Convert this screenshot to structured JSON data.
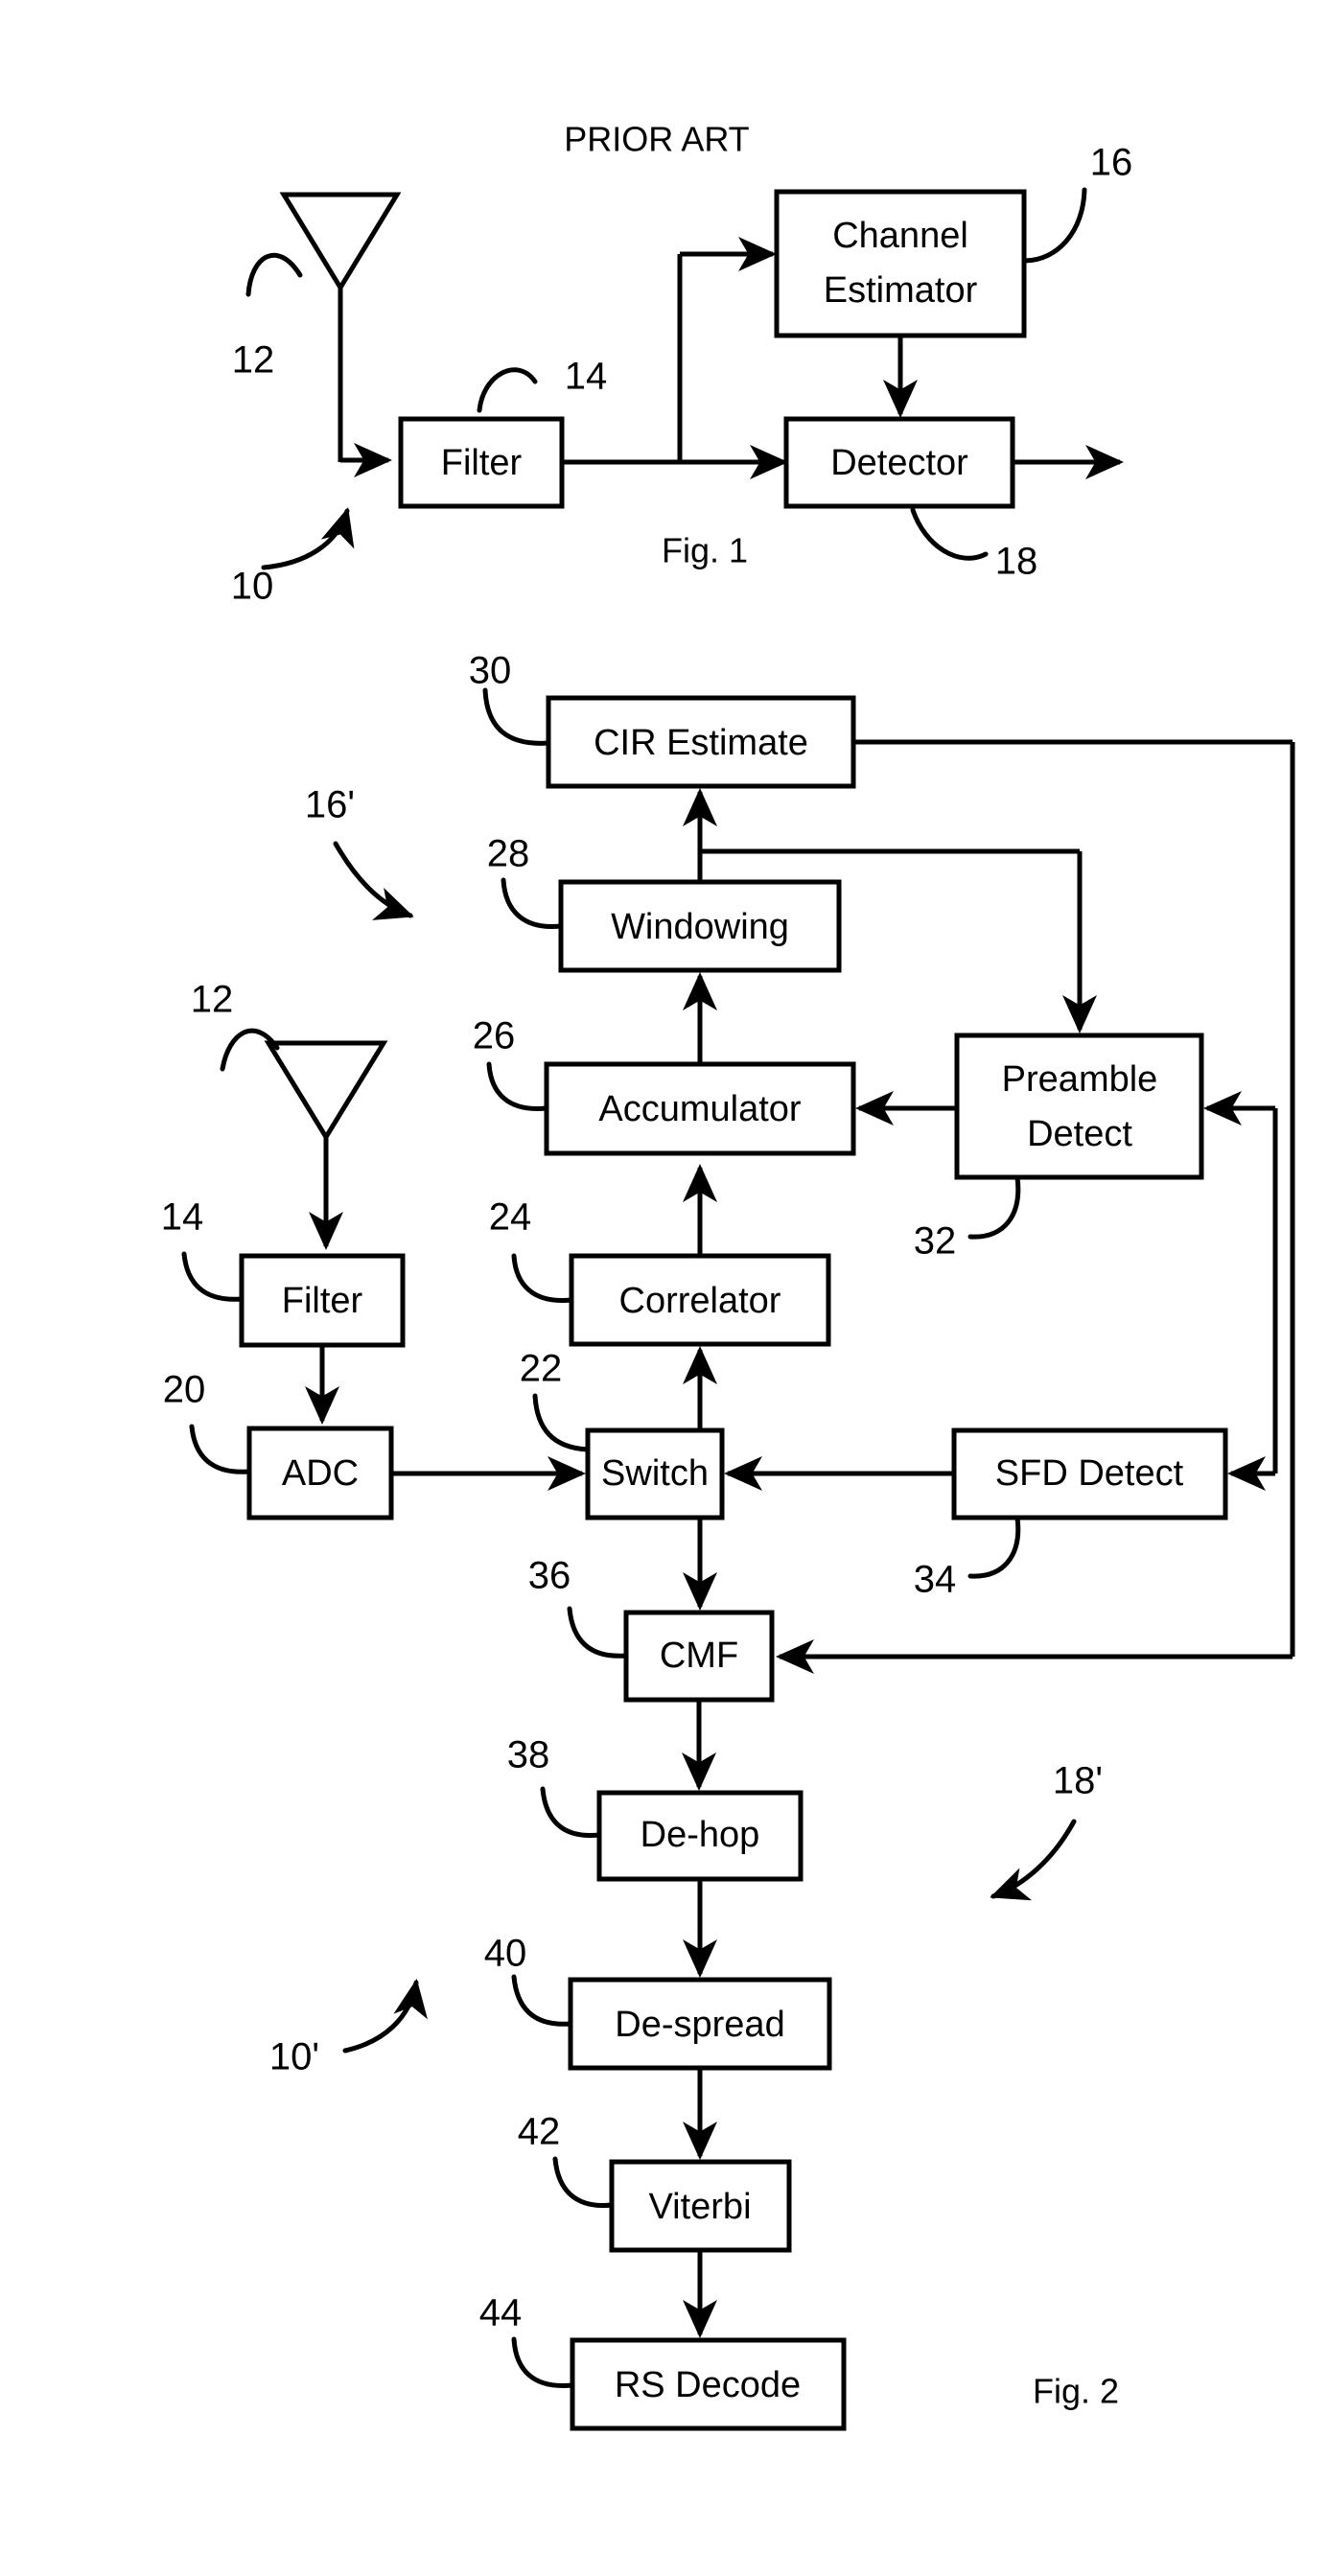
{
  "document": {
    "type": "patent-figure-sheet",
    "figures": [
      {
        "id": "fig1",
        "caption": "Fig. 1",
        "note": "PRIOR ART",
        "system_ref": "10",
        "subsystem_refs": [
          "16'",
          "18'"
        ],
        "blocks": [
          {
            "ref": "12",
            "label": "",
            "kind": "antenna"
          },
          {
            "ref": "14",
            "label": "Filter",
            "kind": "box"
          },
          {
            "ref": "16",
            "label": "Channel Estimator",
            "label_line1": "Channel",
            "label_line2": "Estimator",
            "kind": "box"
          },
          {
            "ref": "18",
            "label": "Detector",
            "kind": "box"
          }
        ]
      },
      {
        "id": "fig2",
        "caption": "Fig. 2",
        "system_ref": "10'",
        "estimator_ref": "16'",
        "detector_ref": "18'",
        "blocks": [
          {
            "ref": "12",
            "label": "",
            "kind": "antenna"
          },
          {
            "ref": "14",
            "label": "Filter",
            "kind": "box"
          },
          {
            "ref": "20",
            "label": "ADC",
            "kind": "box"
          },
          {
            "ref": "22",
            "label": "Switch",
            "kind": "box"
          },
          {
            "ref": "24",
            "label": "Correlator",
            "kind": "box"
          },
          {
            "ref": "26",
            "label": "Accumulator",
            "kind": "box"
          },
          {
            "ref": "28",
            "label": "Windowing",
            "kind": "box"
          },
          {
            "ref": "30",
            "label": "CIR Estimate",
            "kind": "box"
          },
          {
            "ref": "32",
            "label": "Preamble Detect",
            "label_line1": "Preamble",
            "label_line2": "Detect",
            "kind": "box"
          },
          {
            "ref": "34",
            "label": "SFD Detect",
            "kind": "box"
          },
          {
            "ref": "36",
            "label": "CMF",
            "kind": "box"
          },
          {
            "ref": "38",
            "label": "De-hop",
            "kind": "box"
          },
          {
            "ref": "40",
            "label": "De-spread",
            "kind": "box"
          },
          {
            "ref": "42",
            "label": "Viterbi",
            "kind": "box"
          },
          {
            "ref": "44",
            "label": "RS Decode",
            "kind": "box"
          }
        ]
      }
    ],
    "colors": {
      "ink": "#000000",
      "paper": "#ffffff"
    }
  },
  "fig1": {
    "prior_art_note": "PRIOR ART",
    "caption": "Fig. 1",
    "ref_antenna": "12",
    "ref_filter": "14",
    "ref_channel_estimator": "16",
    "ref_detector": "18",
    "ref_system": "10",
    "label_filter": "Filter",
    "label_channel_estimator_line1": "Channel",
    "label_channel_estimator_line2": "Estimator",
    "label_detector": "Detector"
  },
  "fig2": {
    "caption": "Fig. 2",
    "ref_system": "10'",
    "ref_estimator_group": "16'",
    "ref_detector_group": "18'",
    "ref_antenna": "12",
    "ref_filter": "14",
    "ref_adc": "20",
    "ref_switch": "22",
    "ref_correlator": "24",
    "ref_accumulator": "26",
    "ref_windowing": "28",
    "ref_cir_estimate": "30",
    "ref_preamble_detect": "32",
    "ref_sfd_detect": "34",
    "ref_cmf": "36",
    "ref_dehop": "38",
    "ref_despread": "40",
    "ref_viterbi": "42",
    "ref_rs_decode": "44",
    "label_filter": "Filter",
    "label_adc": "ADC",
    "label_switch": "Switch",
    "label_correlator": "Correlator",
    "label_accumulator": "Accumulator",
    "label_windowing": "Windowing",
    "label_cir_estimate": "CIR Estimate",
    "label_preamble_detect_line1": "Preamble",
    "label_preamble_detect_line2": "Detect",
    "label_sfd_detect": "SFD Detect",
    "label_cmf": "CMF",
    "label_dehop": "De-hop",
    "label_despread": "De-spread",
    "label_viterbi": "Viterbi",
    "label_rs_decode": "RS Decode"
  }
}
